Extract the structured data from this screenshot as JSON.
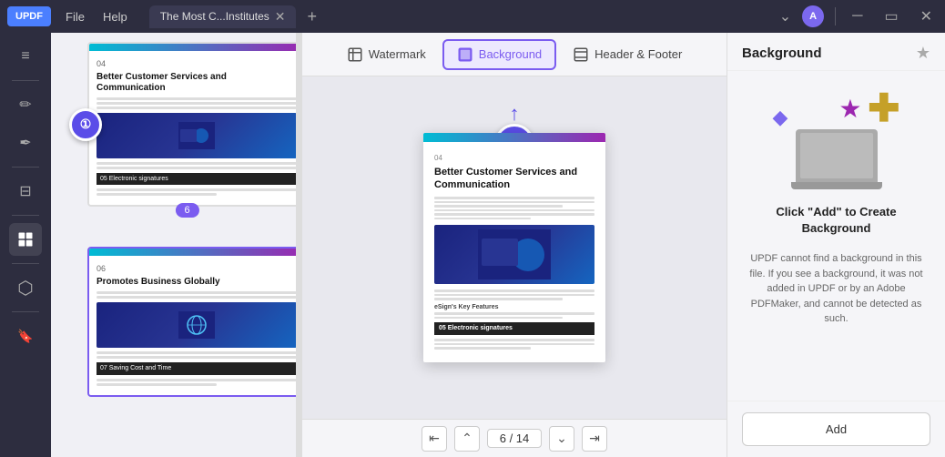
{
  "app": {
    "logo": "UPDF",
    "menu": [
      "File",
      "Help"
    ],
    "tab_label": "The Most C...Institutes",
    "avatar_initial": "A",
    "title": "Background"
  },
  "toolbar": {
    "watermark_label": "Watermark",
    "background_label": "Background",
    "header_footer_label": "Header & Footer",
    "right_panel_title": "Background",
    "star_icon": "☆"
  },
  "right_panel": {
    "illustration_icon": "✚",
    "star_icon": "★",
    "heading": "Click \"Add\" to Create Background",
    "description": "UPDF cannot find a background in this file. If you see a background, it was not added in UPDF or by an Adobe PDFMaker, and cannot be detected as such.",
    "add_button": "Add"
  },
  "page_nav": {
    "current": "6",
    "total": "14",
    "display": "6 / 14"
  },
  "thumbnails": [
    {
      "page_num": "04",
      "title": "Better Customer Services and Communication",
      "has_image": true,
      "section": "05",
      "section_title": "Electronic signatures",
      "badge": "6"
    },
    {
      "page_num": "06",
      "title": "Promotes Business Globally",
      "has_image": true,
      "section": "07",
      "section_title": "Saving Cost and Time"
    }
  ],
  "doc_page": {
    "page_num": "04",
    "title": "Better Customer Services and Communication",
    "has_image": true,
    "section1": "05",
    "section1_title": "Electronic signatures",
    "sub_section": "eSign's Key Features"
  },
  "left_toolbar": {
    "tools": [
      {
        "name": "reader-icon",
        "icon": "≡",
        "active": false
      },
      {
        "name": "separator1"
      },
      {
        "name": "edit-icon",
        "icon": "✏",
        "active": false
      },
      {
        "name": "annotate-icon",
        "icon": "✒",
        "active": false
      },
      {
        "name": "separator2"
      },
      {
        "name": "form-icon",
        "icon": "⊟",
        "active": false
      },
      {
        "name": "separator3"
      },
      {
        "name": "organize-icon",
        "icon": "⊞",
        "active": true
      },
      {
        "name": "separator4"
      },
      {
        "name": "convert-icon",
        "icon": "⬡",
        "active": false
      },
      {
        "name": "bookmark-icon",
        "icon": "🔖",
        "active": false
      }
    ]
  }
}
